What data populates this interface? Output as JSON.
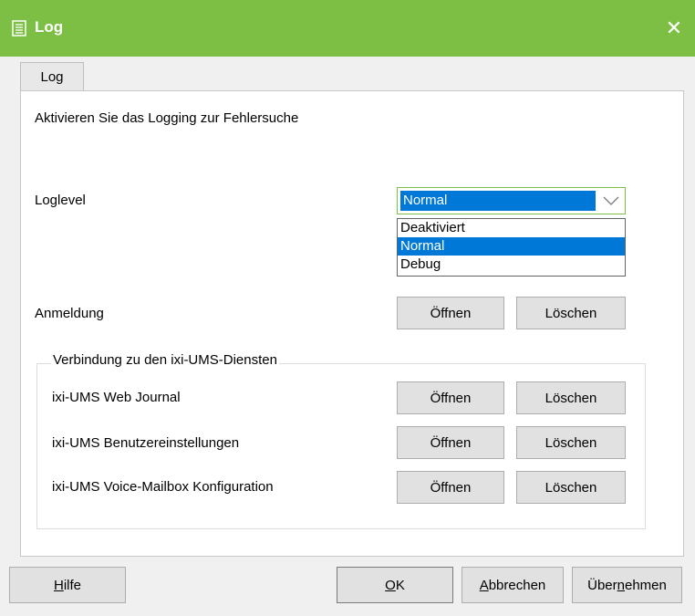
{
  "window": {
    "title": "Log",
    "close_glyph": "✕",
    "title_icon": "document-list-icon",
    "accent_color": "#7dbf44"
  },
  "tabs": [
    {
      "label": "Log",
      "active": true
    }
  ],
  "panel": {
    "description": "Aktivieren Sie das Logging zur Fehlersuche",
    "loglevel": {
      "label": "Loglevel",
      "selected": "Normal",
      "options": [
        "Deaktiviert",
        "Normal",
        "Debug"
      ]
    },
    "anmeldung": {
      "label": "Anmeldung",
      "open_label": "Öffnen",
      "delete_label": "Löschen"
    },
    "group": {
      "legend": "Verbindung zu den ixi-UMS-Diensten",
      "rows": [
        {
          "label": "ixi-UMS Web Journal",
          "open_label": "Öffnen",
          "delete_label": "Löschen"
        },
        {
          "label": "ixi-UMS Benutzereinstellungen",
          "open_label": "Öffnen",
          "delete_label": "Löschen"
        },
        {
          "label": "ixi-UMS Voice-Mailbox Konfiguration",
          "open_label": "Öffnen",
          "delete_label": "Löschen"
        }
      ]
    }
  },
  "footer": {
    "help": {
      "mnemonic": "H",
      "rest": "ilfe"
    },
    "ok": {
      "mnemonic": "O",
      "rest": "K"
    },
    "cancel": {
      "mnemonic": "A",
      "rest": "bbrechen"
    },
    "apply": {
      "pre": "Über",
      "mnemonic": "n",
      "rest": "ehmen"
    }
  }
}
